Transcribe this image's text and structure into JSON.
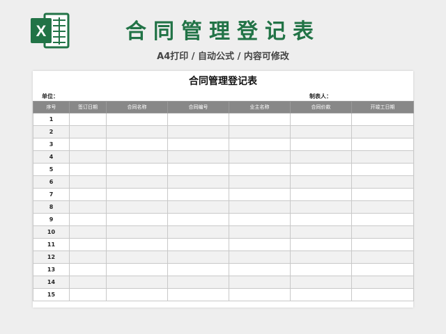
{
  "banner": {
    "logo_letter": "X",
    "title": "合同管理登记表",
    "subtitle": "A4打印 / 自动公式 / 内容可修改"
  },
  "sheet": {
    "title": "合同管理登记表",
    "unit_label": "单位：",
    "maker_label": "制表人："
  },
  "table": {
    "columns": [
      "序号",
      "签订日期",
      "合同名称",
      "合同编号",
      "业主名称",
      "合同价款",
      "开竣工日期"
    ],
    "rows": [
      "1",
      "2",
      "3",
      "4",
      "5",
      "6",
      "7",
      "8",
      "9",
      "10",
      "11",
      "12",
      "13",
      "14",
      "15"
    ]
  },
  "colors": {
    "brand_green": "#217346",
    "header_gray": "#888888",
    "stripe": "#f1f1f1"
  },
  "icons": {
    "logo": "excel-icon"
  }
}
